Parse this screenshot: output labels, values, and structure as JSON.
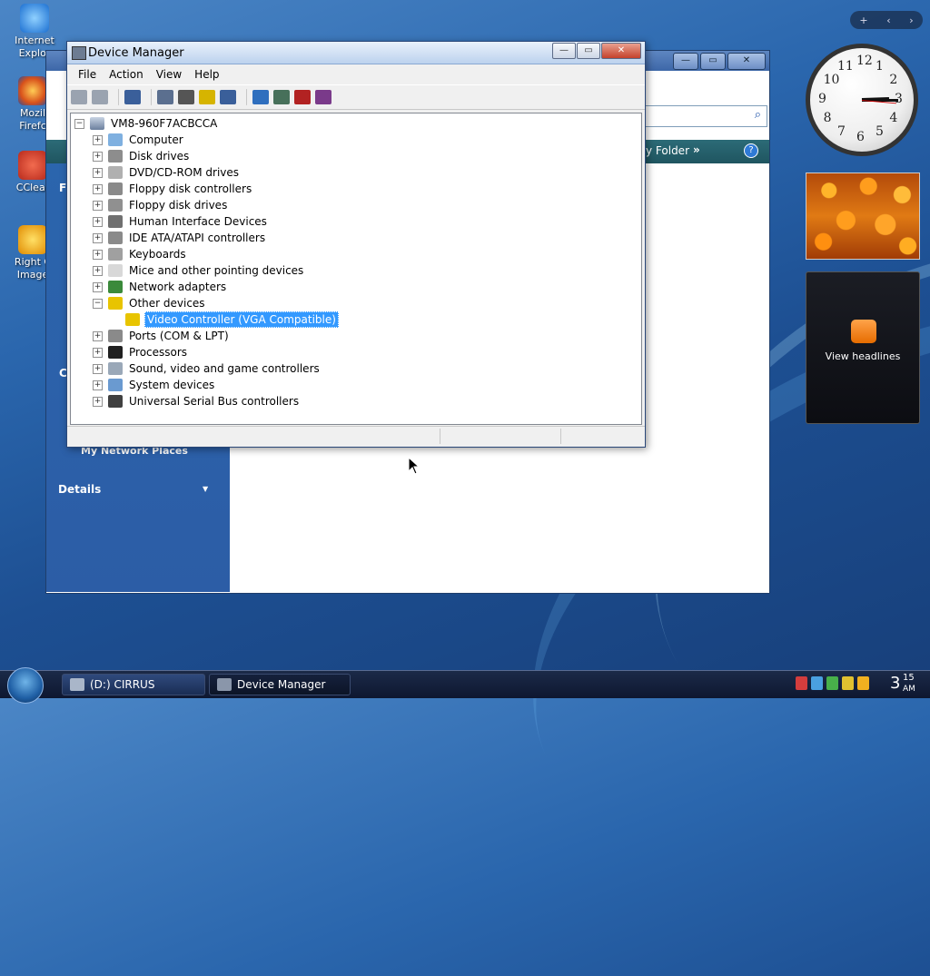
{
  "desktop": {
    "icons": [
      {
        "label_1": "Internet",
        "label_2": "Explor"
      },
      {
        "label_1": "Mozil",
        "label_2": "Firefc"
      },
      {
        "label_1": "CClear",
        "label_2": ""
      },
      {
        "label_1": "Right C",
        "label_2": "Image"
      }
    ]
  },
  "explorer": {
    "cmd_label": "y Folder",
    "cmd_chevron": "»",
    "help": "?",
    "side_letters": [
      "F",
      "C"
    ],
    "network_places": "My Network Places",
    "details": "Details",
    "details_caret": "▼",
    "search_icon": "⌕",
    "buttons": [
      "—",
      "▭",
      "✕"
    ]
  },
  "device_manager": {
    "title": "Device Manager",
    "title_buttons": [
      "—",
      "▭",
      "✕"
    ],
    "menu": [
      "File",
      "Action",
      "View",
      "Help"
    ],
    "toolbar_icons": [
      "back-icon",
      "forward-icon",
      "sep",
      "show-hide-tree-icon",
      "sep",
      "properties-icon",
      "print-icon",
      "help-icon",
      "export-icon",
      "sep",
      "update-driver-icon",
      "scan-changes-icon",
      "uninstall-icon",
      "disable-icon"
    ],
    "root": "VM8-960F7ACBCCA",
    "nodes": [
      {
        "label": "Computer",
        "expander": "+"
      },
      {
        "label": "Disk drives",
        "expander": "+"
      },
      {
        "label": "DVD/CD-ROM drives",
        "expander": "+"
      },
      {
        "label": "Floppy disk controllers",
        "expander": "+"
      },
      {
        "label": "Floppy disk drives",
        "expander": "+"
      },
      {
        "label": "Human Interface Devices",
        "expander": "+"
      },
      {
        "label": "IDE ATA/ATAPI controllers",
        "expander": "+"
      },
      {
        "label": "Keyboards",
        "expander": "+"
      },
      {
        "label": "Mice and other pointing devices",
        "expander": "+"
      },
      {
        "label": "Network adapters",
        "expander": "+"
      },
      {
        "label": "Other devices",
        "expander": "−"
      },
      {
        "label": "Video Controller (VGA Compatible)",
        "expander": "",
        "selected": true
      },
      {
        "label": "Ports (COM & LPT)",
        "expander": "+"
      },
      {
        "label": "Processors",
        "expander": "+"
      },
      {
        "label": "Sound, video and game controllers",
        "expander": "+"
      },
      {
        "label": "System devices",
        "expander": "+"
      },
      {
        "label": "Universal Serial Bus controllers",
        "expander": "+"
      }
    ]
  },
  "sidebar": {
    "top_controls": [
      "+",
      "‹",
      "›"
    ],
    "clock_numbers": [
      "12",
      "1",
      "2",
      "3",
      "4",
      "5",
      "6",
      "7",
      "8",
      "9",
      "10",
      "11"
    ],
    "feed_label": "View headlines"
  },
  "taskbar": {
    "tasks": [
      {
        "label": "(D:) CIRRUS"
      },
      {
        "label": "Device Manager"
      }
    ],
    "time_hour": "3",
    "time_min": "15",
    "time_ampm": "AM"
  }
}
